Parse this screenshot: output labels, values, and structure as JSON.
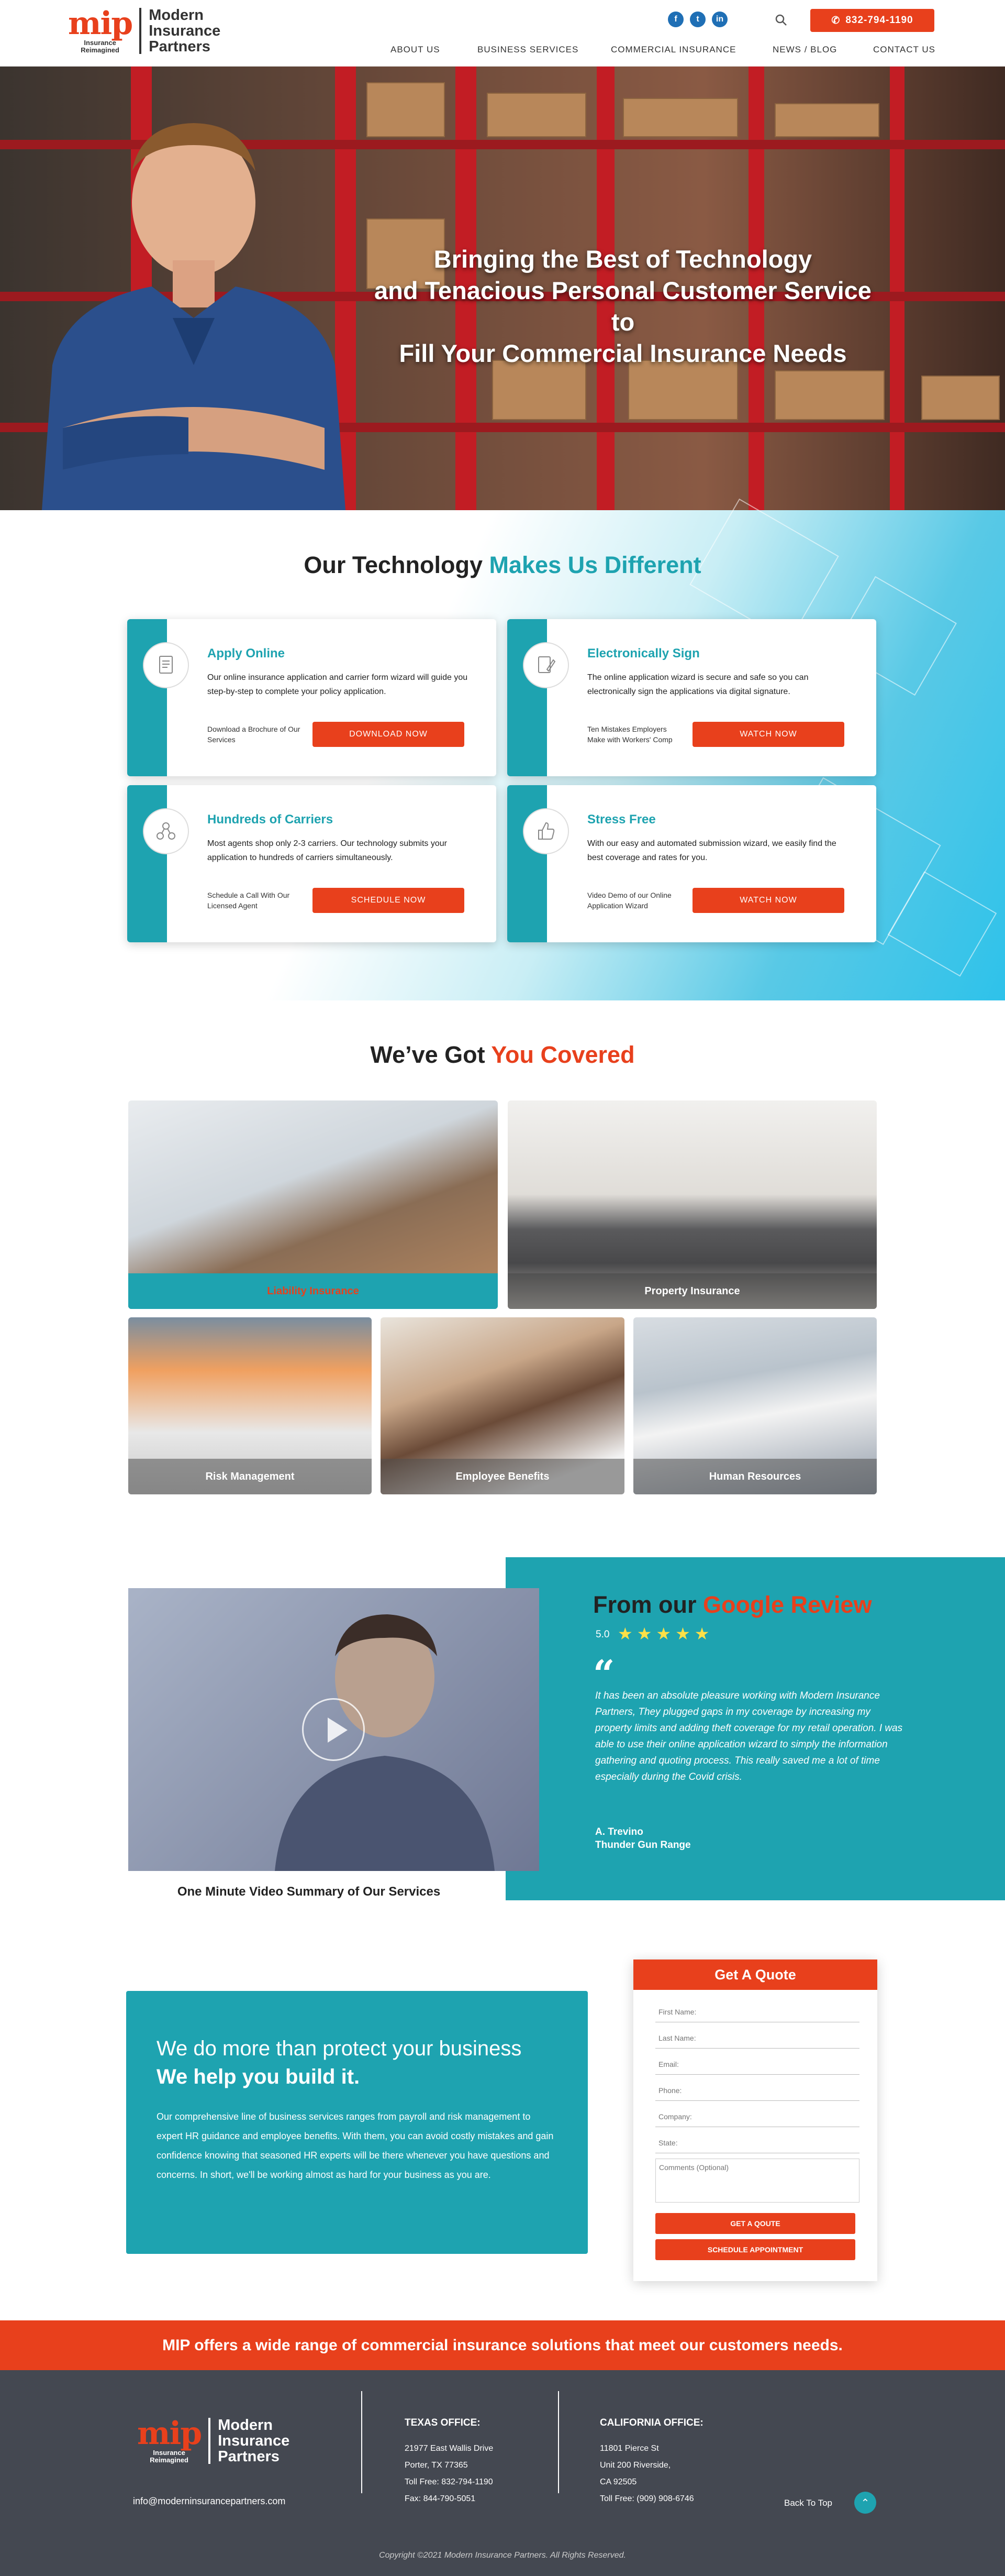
{
  "header": {
    "logo_mip": "mip",
    "logo_tagline_1": "Insurance",
    "logo_tagline_2": "Reimagined",
    "logo_name_1": "Modern",
    "logo_name_2": "Insurance",
    "logo_name_3": "Partners",
    "social": [
      {
        "icon": "facebook-icon",
        "glyph": "f"
      },
      {
        "icon": "twitter-icon",
        "glyph": "t"
      },
      {
        "icon": "linkedin-icon",
        "glyph": "in"
      }
    ],
    "phone": "832-794-1190",
    "nav": [
      "ABOUT US",
      "BUSINESS SERVICES",
      "COMMERCIAL INSURANCE",
      "NEWS / BLOG",
      "CONTACT US"
    ]
  },
  "hero": {
    "line1": "Bringing the Best of Technology",
    "line2": "and Tenacious Personal Customer Service to",
    "line3": "Fill Your Commercial Insurance Needs"
  },
  "tech": {
    "title_a": "Our Technology ",
    "title_b": "Makes Us Different",
    "cards": [
      {
        "title": "Apply Online",
        "text": "Our online insurance application and carrier form wizard will guide you step-by-step to complete your policy application.",
        "note": "Download a Brochure of Our Services",
        "button": "DOWNLOAD NOW",
        "icon": "document-icon"
      },
      {
        "title": "Electronically Sign",
        "text": "The online application wizard is secure and safe so you can electronically sign the applications via digital signature.",
        "note": "Ten Mistakes Employers Make with Workers' Comp",
        "button": "WATCH NOW",
        "icon": "signature-icon"
      },
      {
        "title": "Hundreds of Carriers",
        "text": "Most agents shop only 2-3 carriers. Our technology submits your application to hundreds of carriers simultaneously.",
        "note": "Schedule a Call With Our Licensed Agent",
        "button": "SCHEDULE NOW",
        "icon": "network-icon"
      },
      {
        "title": "Stress Free",
        "text": "With our easy and automated submission wizard, we easily find the best coverage and rates for you.",
        "note": "Video Demo of our Online Application Wizard",
        "button": "WATCH NOW",
        "icon": "thumbs-up-icon"
      }
    ]
  },
  "covered": {
    "title_a": "We’ve Got ",
    "title_b": "You Covered",
    "items": [
      "Liability Insurance",
      "Property Insurance",
      "Risk Management",
      "Employee Benefits",
      "Human Resources"
    ]
  },
  "review": {
    "video_caption": "One Minute Video Summary of Our Services",
    "title_a": "From our ",
    "title_b": "Google Review",
    "rating": "5.0",
    "stars": "★★★★★",
    "quote_mark": "“",
    "text": "It has been an absolute pleasure working with Modern Insurance Partners, They plugged gaps in my coverage by increasing my property limits and adding theft coverage for my retail operation. I was able to use their online application wizard to simply the information gathering and quoting process. This really saved me a lot of time especially during the Covid crisis.",
    "name": "A. Trevino",
    "company": "Thunder Gun Range"
  },
  "protect": {
    "line1": "We do more than protect your business",
    "line2": "We help you build it.",
    "text": "Our comprehensive line of business services ranges from payroll and risk management to expert HR guidance and employee benefits. With them, you can avoid costly mistakes and gain confidence knowing that seasoned HR experts will be there whenever you have questions and concerns. In short, we'll be working almost as hard for your business as you are."
  },
  "quote": {
    "title": "Get A Quote",
    "fields": [
      "First Name:",
      "Last Name:",
      "Email:",
      "Phone:",
      "Company:",
      "State:",
      "Comments (Optional)"
    ],
    "button1": "GET A QOUTE",
    "button2": "SCHEDULE APPOINTMENT"
  },
  "banner": "MIP offers a wide range of commercial insurance solutions that meet our customers needs.",
  "footer": {
    "email": "info@moderninsurancepartners.com",
    "texas": {
      "title": "TEXAS OFFICE:",
      "lines": [
        "21977 East Wallis Drive",
        "Porter, TX 77365",
        "Toll Free: 832-794-1190",
        "Fax: 844-790-5051"
      ]
    },
    "california": {
      "title": "CALIFORNIA OFFICE:",
      "lines": [
        "11801 Pierce St",
        "Unit 200 Riverside,",
        "CA 92505",
        "Toll Free: (909) 908-6746"
      ]
    },
    "back_to_top": "Back To Top",
    "copyright": "Copyright ©2021 Modern Insurance Partners. All Rights Reserved."
  },
  "colors": {
    "accent": "#1ea3b0",
    "brand": "#e8401c",
    "footer": "#444851"
  }
}
